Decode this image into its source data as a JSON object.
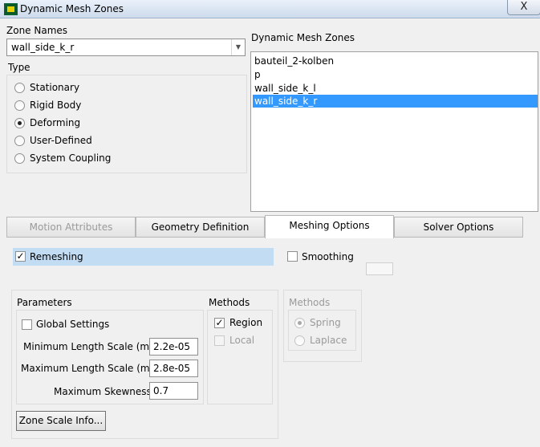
{
  "window": {
    "title": "Dynamic Mesh Zones",
    "close_glyph": "X"
  },
  "zone_names": {
    "label": "Zone Names",
    "selected": "wall_side_k_r"
  },
  "type": {
    "label": "Type",
    "options": [
      {
        "label": "Stationary",
        "checked": false
      },
      {
        "label": "Rigid Body",
        "checked": false
      },
      {
        "label": "Deforming",
        "checked": true
      },
      {
        "label": "User-Defined",
        "checked": false
      },
      {
        "label": "System Coupling",
        "checked": false
      }
    ]
  },
  "dynamic_zones": {
    "label": "Dynamic Mesh Zones",
    "items": [
      "bauteil_2-kolben",
      "p",
      "wall_side_k_l",
      "wall_side_k_r"
    ],
    "selected_index": 3
  },
  "tabs": [
    "Motion Attributes",
    "Geometry Definition",
    "Meshing Options",
    "Solver Options"
  ],
  "active_tab": 2,
  "meshing": {
    "remeshing_label": "Remeshing",
    "remeshing_checked": true,
    "smoothing_label": "Smoothing",
    "smoothing_checked": false
  },
  "parameters": {
    "label": "Parameters",
    "global_settings_label": "Global Settings",
    "global_settings_checked": false,
    "min_length_label": "Minimum Length Scale (m)",
    "min_length_value": "2.2e-05",
    "max_length_label": "Maximum Length Scale (m)",
    "max_length_value": "2.8e-05",
    "max_skewness_label": "Maximum Skewness",
    "max_skewness_value": "0.7",
    "zone_scale_button": "Zone Scale Info..."
  },
  "methods_remesh": {
    "label": "Methods",
    "region_label": "Region",
    "region_checked": true,
    "local_label": "Local",
    "local_checked": false
  },
  "methods_smooth": {
    "label": "Methods",
    "spring_label": "Spring",
    "spring_checked": true,
    "laplace_label": "Laplace",
    "laplace_checked": false
  },
  "colors": {
    "selection": "#3399ff",
    "remesh_highlight": "#c2dcf4"
  }
}
